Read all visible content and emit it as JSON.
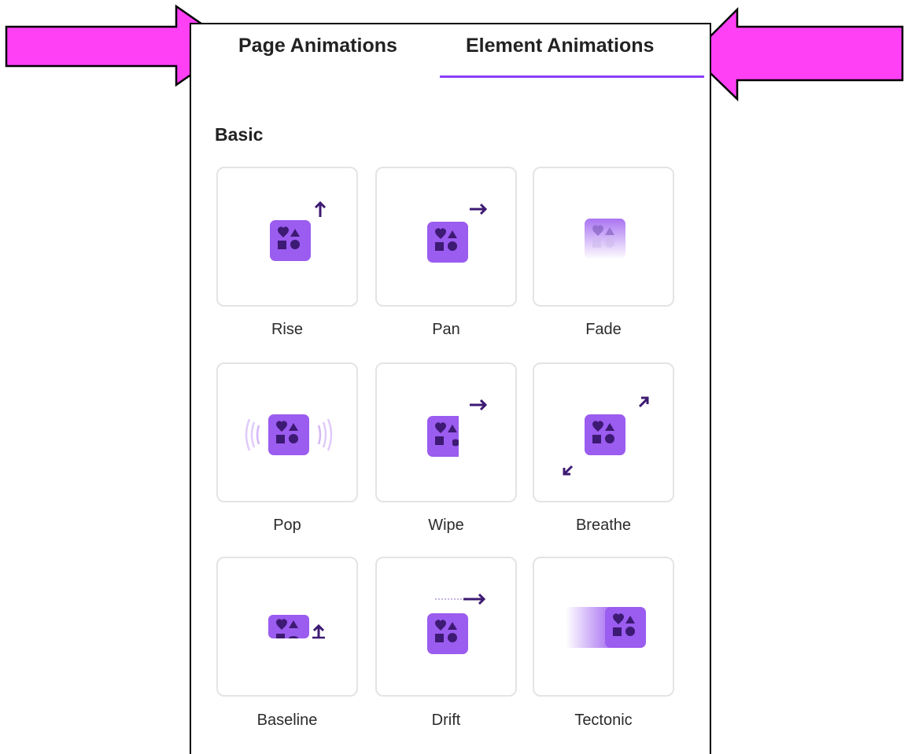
{
  "tabs": {
    "page_label": "Page Animations",
    "element_label": "Element Animations",
    "active": "Element Animations"
  },
  "section": {
    "title": "Basic"
  },
  "animations": [
    {
      "label": "Rise",
      "icon": "rise-icon"
    },
    {
      "label": "Pan",
      "icon": "pan-icon"
    },
    {
      "label": "Fade",
      "icon": "fade-icon"
    },
    {
      "label": "Pop",
      "icon": "pop-icon"
    },
    {
      "label": "Wipe",
      "icon": "wipe-icon"
    },
    {
      "label": "Breathe",
      "icon": "breathe-icon"
    },
    {
      "label": "Baseline",
      "icon": "baseline-icon"
    },
    {
      "label": "Drift",
      "icon": "drift-icon"
    },
    {
      "label": "Tectonic",
      "icon": "tectonic-icon"
    }
  ],
  "colors": {
    "accent": "#8b3dff",
    "shape_bg": "#9b5cf0",
    "shape_fg": "#3d1a73",
    "arrow_dark": "#3d1a73",
    "callout_arrow": "#ff40f5"
  }
}
